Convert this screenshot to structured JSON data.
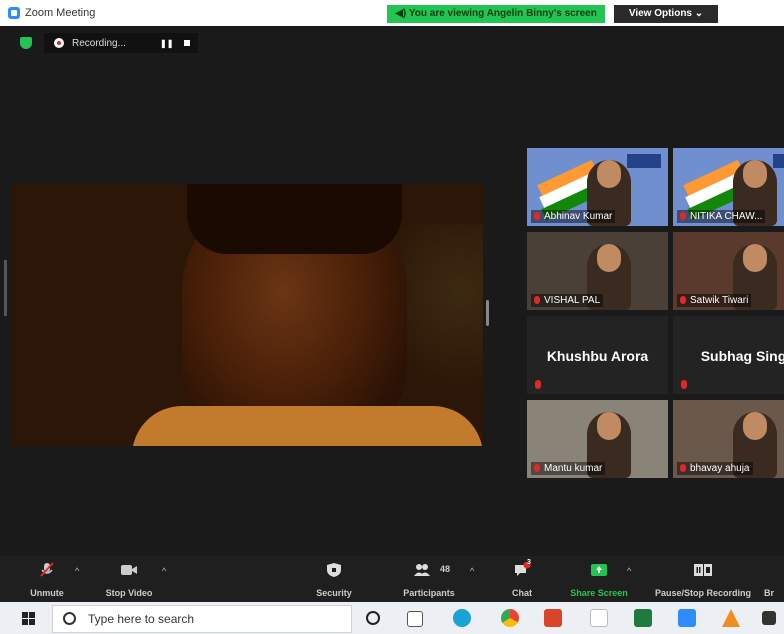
{
  "window": {
    "title": "Zoom Meeting"
  },
  "banner": {
    "viewing_text": "You are viewing Angelin Binny's screen",
    "view_options_label": "View Options ⌄"
  },
  "recording": {
    "label": "Recording..."
  },
  "participants": [
    {
      "name": "Abhinav Kumar",
      "style": "flag"
    },
    {
      "name": "NITIKA CHAW...",
      "style": "flag"
    },
    {
      "name": "VISHAL PAL",
      "style": "room"
    },
    {
      "name": "Satwik Tiwari",
      "style": "room2"
    },
    {
      "name": "Khushbu Arora",
      "style": "textonly"
    },
    {
      "name": "Subhag Sing",
      "style": "textonly"
    },
    {
      "name": "Mantu kumar",
      "style": "room3"
    },
    {
      "name": "bhavay ahuja",
      "style": "room4"
    }
  ],
  "toolbar": {
    "unmute": "Unmute",
    "stop_video": "Stop Video",
    "security": "Security",
    "participants": "Participants",
    "participants_count": "48",
    "chat": "Chat",
    "chat_badge": "3",
    "share_screen": "Share Screen",
    "pause_stop_recording": "Pause/Stop Recording",
    "truncated": "Br"
  },
  "taskbar": {
    "search_placeholder": "Type here to search"
  },
  "colors": {
    "accent_green": "#23c552",
    "zoom_blue": "#2d8cff",
    "mute_red": "#e02828"
  }
}
